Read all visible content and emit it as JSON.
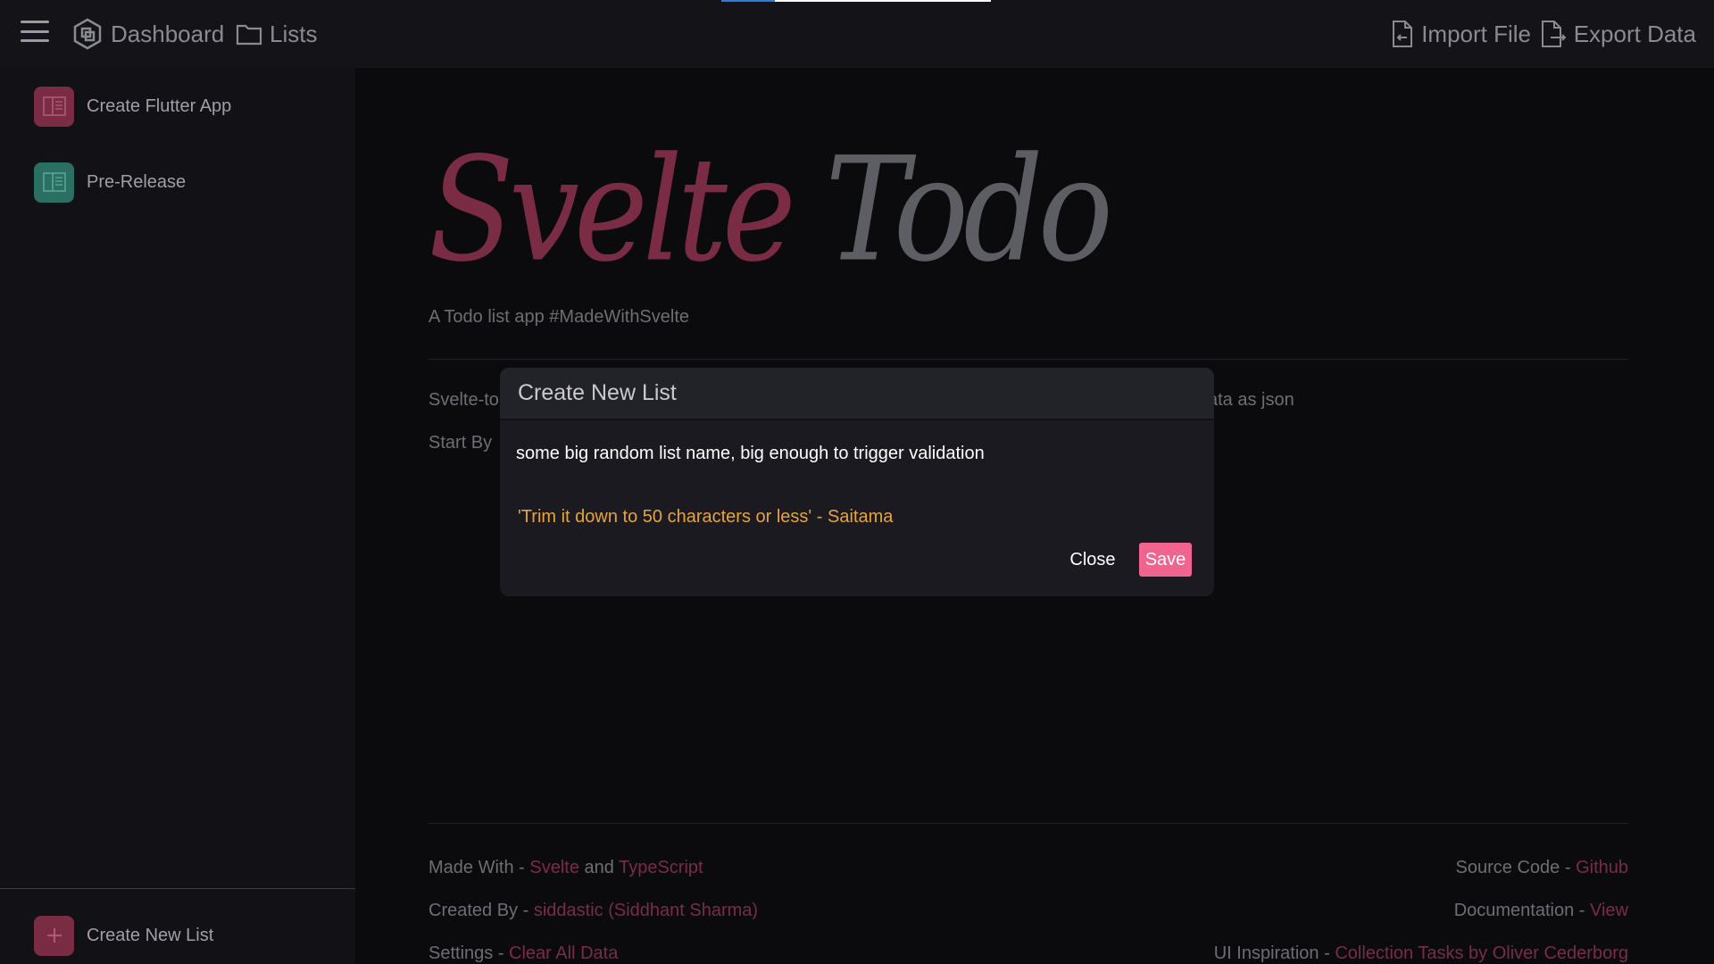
{
  "topbar": {
    "dashboard_label": "Dashboard",
    "lists_label": "Lists",
    "import_label": "Import File",
    "export_label": "Export Data"
  },
  "sidebar": {
    "items": [
      {
        "label": "Create Flutter App",
        "color": "#7a2c45",
        "icon": "book-icon"
      },
      {
        "label": "Pre-Release",
        "color": "#2b6e62",
        "icon": "book-icon"
      }
    ],
    "create_new_label": "Create New List",
    "create_new_color": "#7a2c45"
  },
  "main": {
    "title_words": [
      "Svelte",
      "Todo"
    ],
    "subtitle": "A Todo list app #MadeWithSvelte",
    "desc1_start": "Svelte-to",
    "desc1_end": "ata as json",
    "desc2_start": "Start By"
  },
  "footer": {
    "made_with_prefix": "Made With - ",
    "made_with_link1": "Svelte",
    "made_with_and": " and ",
    "made_with_link2": "TypeScript",
    "created_by_prefix": "Created By - ",
    "created_by_link": "siddastic (Siddhant Sharma)",
    "settings_prefix": "Settings - ",
    "settings_link": "Clear All Data",
    "source_prefix": "Source Code - ",
    "source_link": "Github",
    "docs_prefix": "Documentation - ",
    "docs_link": "View",
    "inspiration_prefix": "UI Inspiration - ",
    "inspiration_link": "Collection Tasks by Oliver Cederborg"
  },
  "modal": {
    "title": "Create New List",
    "input_value": "some big random list name, big enough to trigger validation",
    "error": "'Trim it down to 50 characters or less' - Saitama",
    "close_label": "Close",
    "save_label": "Save",
    "save_color": "#f1648f",
    "error_color": "#e8a33a"
  }
}
